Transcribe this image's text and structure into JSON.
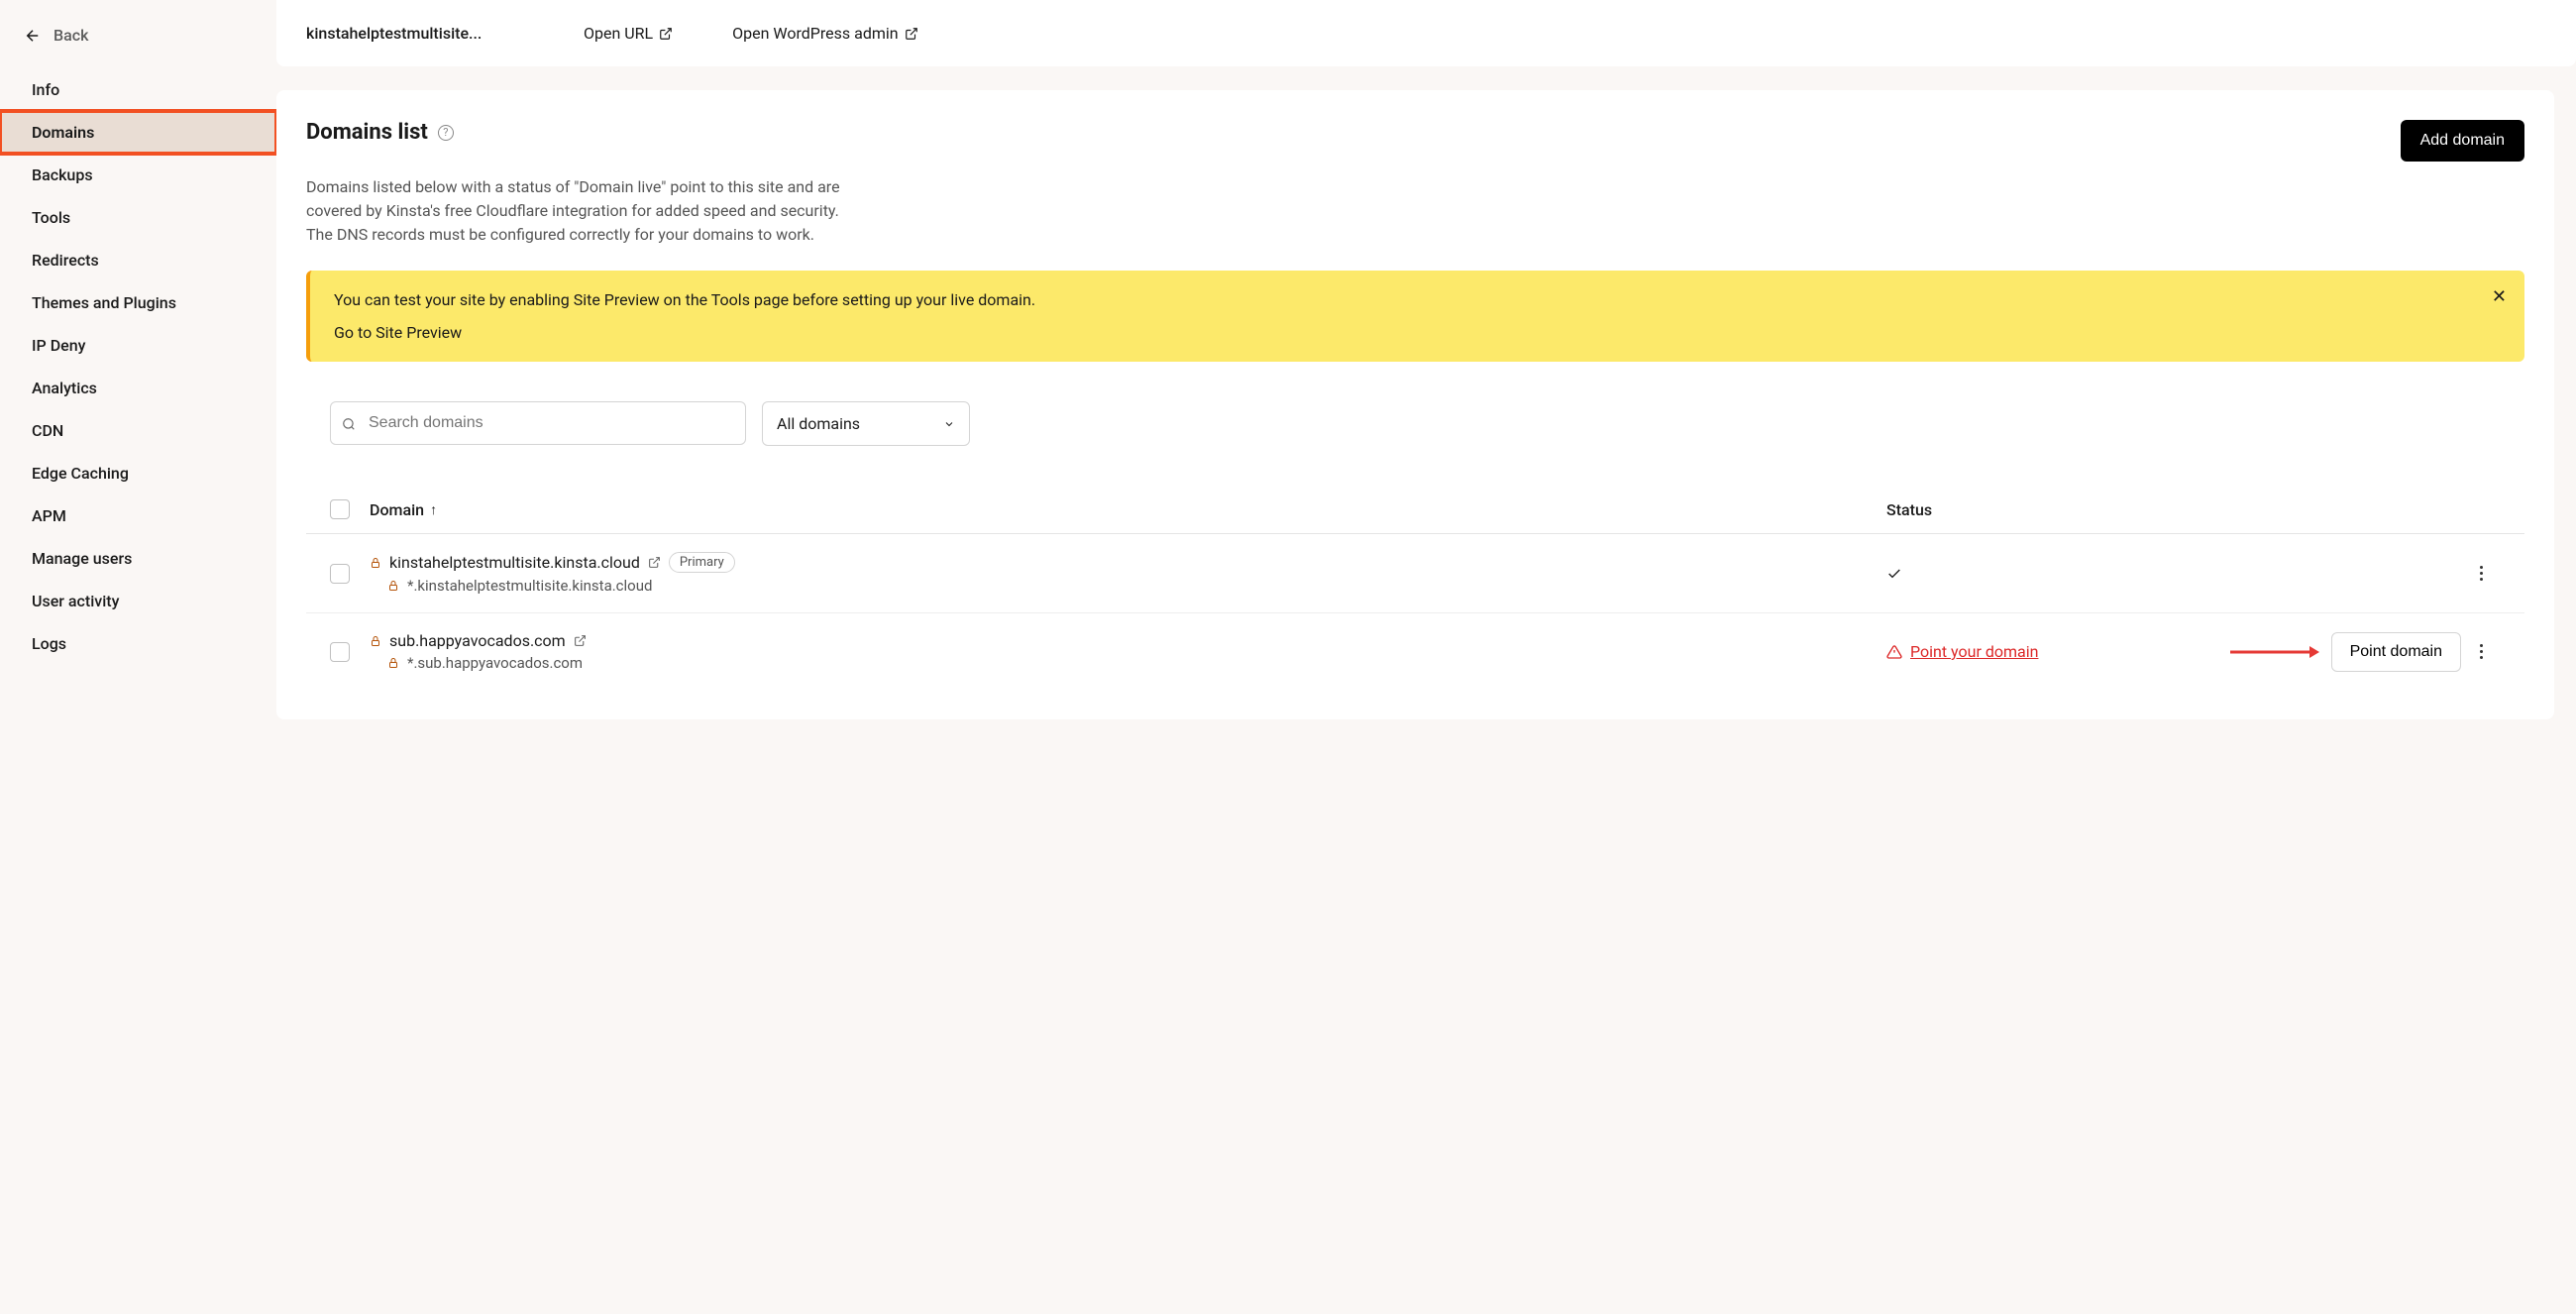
{
  "sidebar": {
    "back": "Back",
    "items": [
      {
        "label": "Info"
      },
      {
        "label": "Domains",
        "active": true
      },
      {
        "label": "Backups"
      },
      {
        "label": "Tools"
      },
      {
        "label": "Redirects"
      },
      {
        "label": "Themes and Plugins"
      },
      {
        "label": "IP Deny"
      },
      {
        "label": "Analytics"
      },
      {
        "label": "CDN"
      },
      {
        "label": "Edge Caching"
      },
      {
        "label": "APM"
      },
      {
        "label": "Manage users"
      },
      {
        "label": "User activity"
      },
      {
        "label": "Logs"
      }
    ]
  },
  "topbar": {
    "site_name": "kinstahelptestmultisite...",
    "open_url": "Open URL",
    "open_wp": "Open WordPress admin"
  },
  "panel": {
    "title": "Domains list",
    "add_button": "Add domain",
    "description": "Domains listed below with a status of \"Domain live\" point to this site and are covered by Kinsta's free Cloudflare integration for added speed and security. The DNS records must be configured correctly for your domains to work."
  },
  "alert": {
    "text": "You can test your site by enabling Site Preview on the Tools page before setting up your live domain.",
    "link": "Go to Site Preview"
  },
  "search": {
    "placeholder": "Search domains"
  },
  "filter": {
    "selected": "All domains"
  },
  "table": {
    "col_domain": "Domain",
    "col_status": "Status",
    "rows": [
      {
        "domain": "kinstahelptestmultisite.kinsta.cloud",
        "wildcard": "*.kinstahelptestmultisite.kinsta.cloud",
        "badge": "Primary",
        "status": "check"
      },
      {
        "domain": "sub.happyavocados.com",
        "wildcard": "*.sub.happyavocados.com",
        "status": "warn",
        "status_text": "Point your domain",
        "action_button": "Point domain"
      }
    ]
  }
}
